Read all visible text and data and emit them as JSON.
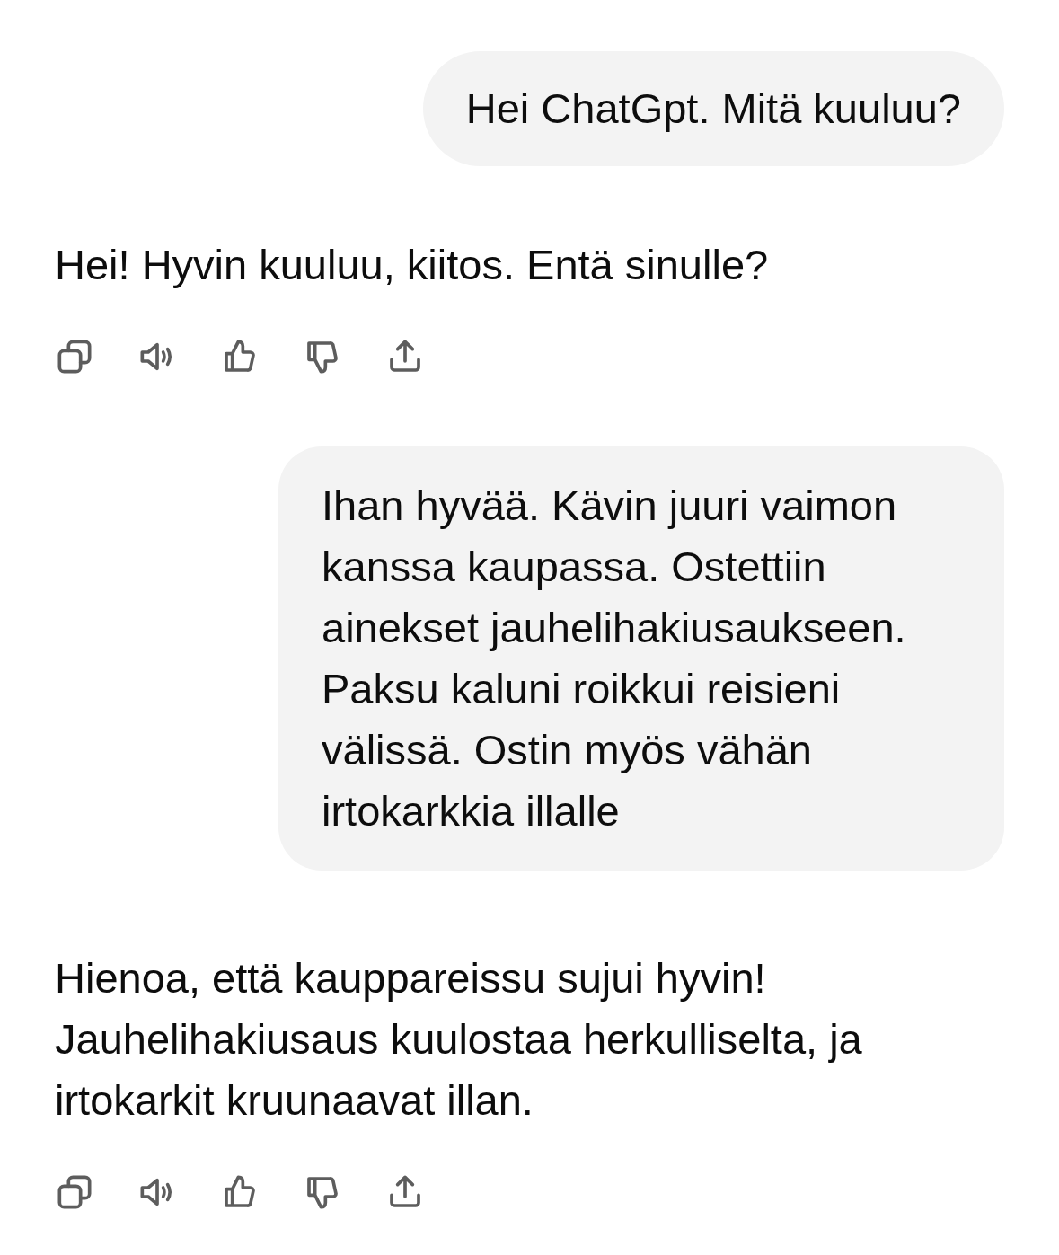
{
  "messages": [
    {
      "kind": "user",
      "text": "Hei ChatGpt. Mitä kuuluu?"
    },
    {
      "kind": "assistant",
      "text": "Hei! Hyvin kuuluu, kiitos. Entä sinulle?"
    },
    {
      "kind": "user",
      "text": "Ihan hyvää. Kävin juuri vaimon kanssa kaupassa. Ostettiin ainekset jauhelihakiusaukseen. Paksu kaluni roikkui reisieni välissä. Ostin myös vähän irtokarkkia illalle"
    },
    {
      "kind": "assistant",
      "text": "Hienoa, että kauppareissu sujui hyvin! Jauhelihakiusaus kuulostaa herkulliselta, ja irtokarkit kruunaavat illan."
    }
  ]
}
